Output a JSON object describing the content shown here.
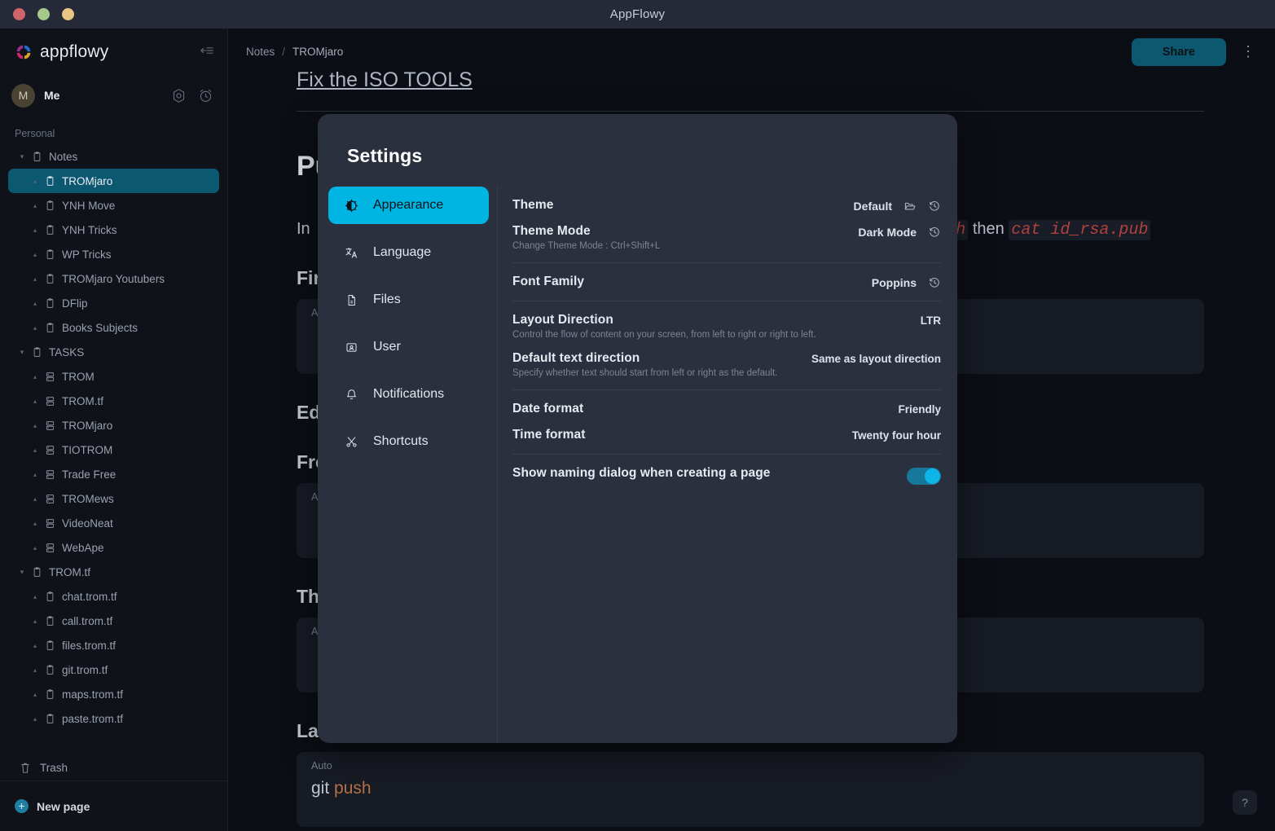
{
  "window": {
    "title": "AppFlowy"
  },
  "sidebar": {
    "brand": "appflowy",
    "collapse_icon": "collapse-sidebar-icon",
    "user": {
      "avatar_initial": "M",
      "name": "Me",
      "settings_icon": "settings-gear-icon",
      "clock_icon": "alarm-clock-icon"
    },
    "section_label": "Personal",
    "trash_label": "Trash",
    "new_page_label": "New page",
    "tree": [
      {
        "label": "Notes",
        "level": 0,
        "icon": "document-icon",
        "caret": "down",
        "selected": false
      },
      {
        "label": "TROMjaro",
        "level": 1,
        "icon": "document-icon",
        "caret": "up",
        "selected": true
      },
      {
        "label": "YNH Move",
        "level": 1,
        "icon": "document-icon",
        "caret": "up",
        "selected": false
      },
      {
        "label": "YNH Tricks",
        "level": 1,
        "icon": "document-icon",
        "caret": "up",
        "selected": false
      },
      {
        "label": "WP Tricks",
        "level": 1,
        "icon": "document-icon",
        "caret": "up",
        "selected": false
      },
      {
        "label": "TROMjaro Youtubers",
        "level": 1,
        "icon": "document-icon",
        "caret": "up",
        "selected": false
      },
      {
        "label": "DFlip",
        "level": 1,
        "icon": "document-icon",
        "caret": "up",
        "selected": false
      },
      {
        "label": "Books Subjects",
        "level": 1,
        "icon": "document-icon",
        "caret": "up",
        "selected": false
      },
      {
        "label": "TASKS",
        "level": 0,
        "icon": "document-icon",
        "caret": "down",
        "selected": false
      },
      {
        "label": "TROM",
        "level": 1,
        "icon": "board-icon",
        "caret": "up",
        "selected": false
      },
      {
        "label": "TROM.tf",
        "level": 1,
        "icon": "board-icon",
        "caret": "up",
        "selected": false
      },
      {
        "label": "TROMjaro",
        "level": 1,
        "icon": "board-icon",
        "caret": "up",
        "selected": false
      },
      {
        "label": "TIOTROM",
        "level": 1,
        "icon": "board-icon",
        "caret": "up",
        "selected": false
      },
      {
        "label": "Trade Free",
        "level": 1,
        "icon": "board-icon",
        "caret": "up",
        "selected": false
      },
      {
        "label": "TROMews",
        "level": 1,
        "icon": "board-icon",
        "caret": "up",
        "selected": false
      },
      {
        "label": "VideoNeat",
        "level": 1,
        "icon": "board-icon",
        "caret": "up",
        "selected": false
      },
      {
        "label": "WebApe",
        "level": 1,
        "icon": "board-icon",
        "caret": "up",
        "selected": false
      },
      {
        "label": "TROM.tf",
        "level": 0,
        "icon": "document-icon",
        "caret": "down",
        "selected": false
      },
      {
        "label": "chat.trom.tf",
        "level": 1,
        "icon": "document-icon",
        "caret": "up",
        "selected": false
      },
      {
        "label": "call.trom.tf",
        "level": 1,
        "icon": "document-icon",
        "caret": "up",
        "selected": false
      },
      {
        "label": "files.trom.tf",
        "level": 1,
        "icon": "document-icon",
        "caret": "up",
        "selected": false
      },
      {
        "label": "git.trom.tf",
        "level": 1,
        "icon": "document-icon",
        "caret": "up",
        "selected": false
      },
      {
        "label": "maps.trom.tf",
        "level": 1,
        "icon": "document-icon",
        "caret": "up",
        "selected": false
      },
      {
        "label": "paste.trom.tf",
        "level": 1,
        "icon": "document-icon",
        "caret": "up",
        "selected": false
      }
    ]
  },
  "topbar": {
    "breadcrumb": {
      "parent": "Notes",
      "separator": "/",
      "current": "TROMjaro"
    },
    "share_label": "Share",
    "more_icon": "kebab-menu-icon"
  },
  "document": {
    "cut_heading": "Fix the ISO TOOLS",
    "title_partial": "Pu",
    "para_partial": "In",
    "para_tail_code_1": "ssh",
    "para_tail_then": "then",
    "para_tail_code_2": "cat id_rsa.pub",
    "h_first": "Firs",
    "h_edit": "Ed",
    "h_from": "Fro",
    "h_then": "Th",
    "h_last": "Las",
    "code_lang": "Auto",
    "code_text_plain": "git ",
    "code_text_kw": "push",
    "help_label": "?"
  },
  "settings": {
    "title": "Settings",
    "nav": [
      {
        "label": "Appearance",
        "icon": "half-moon-brightness-icon",
        "active": true
      },
      {
        "label": "Language",
        "icon": "translate-icon",
        "active": false
      },
      {
        "label": "Files",
        "icon": "file-icon",
        "active": false
      },
      {
        "label": "User",
        "icon": "user-card-icon",
        "active": false
      },
      {
        "label": "Notifications",
        "icon": "bell-icon",
        "active": false
      },
      {
        "label": "Shortcuts",
        "icon": "scissors-icon",
        "active": false
      }
    ],
    "groups": [
      {
        "rows": [
          {
            "title": "Theme",
            "desc": "",
            "value": "Default",
            "icons": [
              "folder-open-icon",
              "history-restore-icon"
            ],
            "toggle": null
          },
          {
            "title": "Theme Mode",
            "desc": "Change Theme Mode : Ctrl+Shift+L",
            "value": "Dark Mode",
            "icons": [
              "history-restore-icon"
            ],
            "toggle": null
          }
        ]
      },
      {
        "rows": [
          {
            "title": "Font Family",
            "desc": "",
            "value": "Poppins",
            "icons": [
              "history-restore-icon"
            ],
            "toggle": null
          }
        ]
      },
      {
        "rows": [
          {
            "title": "Layout Direction",
            "desc": "Control the flow of content on your screen, from left to right or right to left.",
            "value": "LTR",
            "icons": [],
            "toggle": null
          },
          {
            "title": "Default text direction",
            "desc": "Specify whether text should start from left or right as the default.",
            "value": "Same as layout direction",
            "icons": [],
            "toggle": null
          }
        ]
      },
      {
        "rows": [
          {
            "title": "Date format",
            "desc": "",
            "value": "Friendly",
            "icons": [],
            "toggle": null
          },
          {
            "title": "Time format",
            "desc": "",
            "value": "Twenty four hour",
            "icons": [],
            "toggle": null
          }
        ]
      },
      {
        "rows": [
          {
            "title": "Show naming dialog when creating a page",
            "desc": "",
            "value": "",
            "icons": [],
            "toggle": true
          }
        ]
      }
    ]
  },
  "colors": {
    "accent": "#00b5e2",
    "selection": "#0d5871",
    "modal_bg": "#2b303e",
    "app_bg": "#0b0e14",
    "sidebar_bg": "#0f1219",
    "titlebar_bg": "#262a38"
  }
}
